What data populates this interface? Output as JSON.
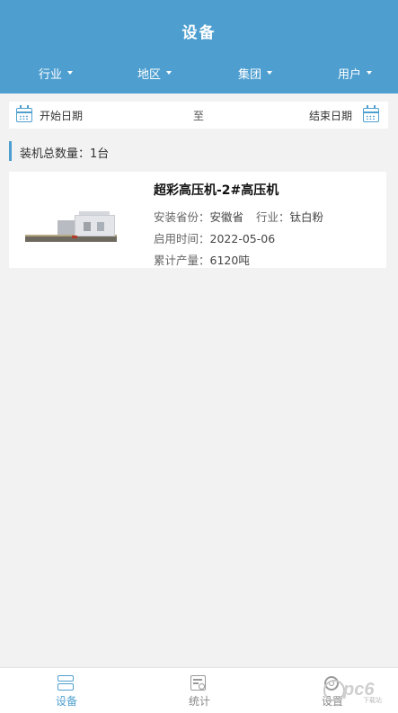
{
  "header": {
    "title": "设备",
    "filters": [
      {
        "label": "行业"
      },
      {
        "label": "地区"
      },
      {
        "label": "集团"
      },
      {
        "label": "用户"
      }
    ],
    "background": "#4e9fd0"
  },
  "date_range": {
    "start_label": "开始日期",
    "separator": "至",
    "end_label": "结束日期",
    "icon": "calendar-icon"
  },
  "summary": {
    "text": "装机总数量：1台"
  },
  "devices": [
    {
      "name": "超彩高压机-2#高压机",
      "province_label": "安装省份：",
      "province": "安徽省",
      "industry_label": "行业：",
      "industry": "钛白粉",
      "start_label": "启用时间：",
      "start_date": "2022-05-06",
      "output_label": "累计产量：",
      "output": "6120吨"
    }
  ],
  "tabbar": {
    "tabs": [
      {
        "label": "设备",
        "icon": "device-icon",
        "active": true
      },
      {
        "label": "统计",
        "icon": "statistics-icon",
        "active": false
      },
      {
        "label": "设置",
        "icon": "settings-icon",
        "active": false
      }
    ],
    "active_color": "#4e9fd0"
  },
  "watermark": {
    "text": "pc6",
    "sub": "下载站"
  }
}
